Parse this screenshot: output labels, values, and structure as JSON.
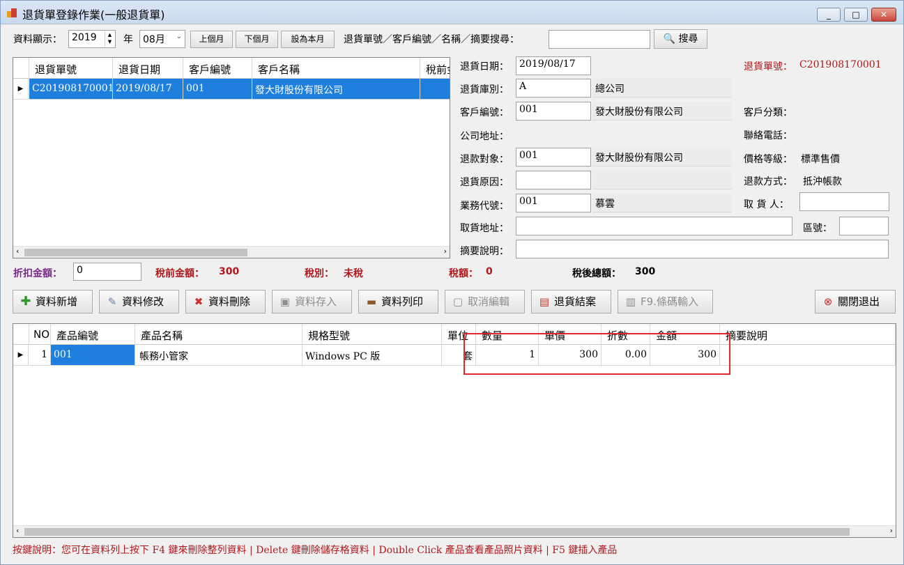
{
  "window": {
    "title": "退貨單登錄作業(一般退貨單)",
    "minimize": "_",
    "maximize": "□",
    "close": "✕"
  },
  "toolbar": {
    "display_label": "資料顯示：",
    "year_value": "2019",
    "year_unit": "年",
    "month_value": "08月",
    "prev_month": "上個月",
    "next_month": "下個月",
    "this_month": "設為本月",
    "search_label": "退貨單號／客戶編號／名稱／摘要搜尋：",
    "search_value": "",
    "search_button": "搜尋"
  },
  "list": {
    "columns": [
      "退貨單號",
      "退貨日期",
      "客戶編號",
      "客戶名稱",
      "稅前金"
    ],
    "rows": [
      {
        "no": "C201908170001",
        "date": "2019/08/17",
        "cust_id": "001",
        "cust_name": "發大財股份有限公司",
        "pretax": ""
      }
    ]
  },
  "form": {
    "return_date_label": "退貨日期：",
    "return_date": "2019/08/17",
    "return_no_label": "退貨單號：",
    "return_no": "C201908170001",
    "warehouse_label": "退貨庫別：",
    "warehouse_code": "A",
    "warehouse_name": "總公司",
    "customer_id_label": "客戶編號：",
    "customer_id": "001",
    "customer_name": "發大財股份有限公司",
    "customer_category_label": "客戶分類：",
    "customer_category": "",
    "address_label": "公司地址：",
    "address": "",
    "phone_label": "聯絡電話：",
    "phone": "",
    "refund_target_label": "退款對象：",
    "refund_target_id": "001",
    "refund_target_name": "發大財股份有限公司",
    "price_level_label": "價格等級：",
    "price_level": "標準售價",
    "reason_label": "退貨原因：",
    "reason_code": "",
    "reason_text": "",
    "refund_method_label": "退款方式：",
    "refund_method": "抵沖帳款",
    "sales_label": "業務代號：",
    "sales_id": "001",
    "sales_name": "慕雲",
    "pickup_person_label": "取 貨 人：",
    "pickup_person": "",
    "pickup_address_label": "取貨地址：",
    "pickup_address": "",
    "zip_label": "區號：",
    "zip": "",
    "summary_label": "摘要說明：",
    "summary": ""
  },
  "totals": {
    "discount_label": "折扣金額：",
    "discount_value": "0",
    "pretax_label": "稅前金額：",
    "pretax_value": "300",
    "tax_type_label": "稅別：",
    "tax_type_value": "未稅",
    "tax_label": "稅額：",
    "tax_value": "0",
    "after_tax_label": "稅後總額：",
    "after_tax_value": "300"
  },
  "actions": {
    "add": "資料新增",
    "edit": "資料修改",
    "delete": "資料刪除",
    "save": "資料存入",
    "print": "資料列印",
    "cancel": "取消編輯",
    "close_case": "退貨結案",
    "barcode": "F9.條碼輸入",
    "exit": "關閉退出"
  },
  "detail": {
    "columns": [
      "NO",
      "產品編號",
      "產品名稱",
      "規格型號",
      "單位",
      "數量",
      "單價",
      "折數",
      "金額",
      "摘要說明"
    ],
    "rows": [
      {
        "no": "1",
        "product_id": "001",
        "product_name": "帳務小管家",
        "spec": "Windows PC 版",
        "unit": "套",
        "qty": "1",
        "price": "300",
        "discount": "0.00",
        "amount": "300",
        "note": ""
      }
    ]
  },
  "hint": "按鍵說明：您可在資料列上按下 F4 鍵來刪除整列資料 | Delete 鍵刪除儲存格資料 | Double Click 產品查看產品照片資料 | F5 鍵插入產品"
}
